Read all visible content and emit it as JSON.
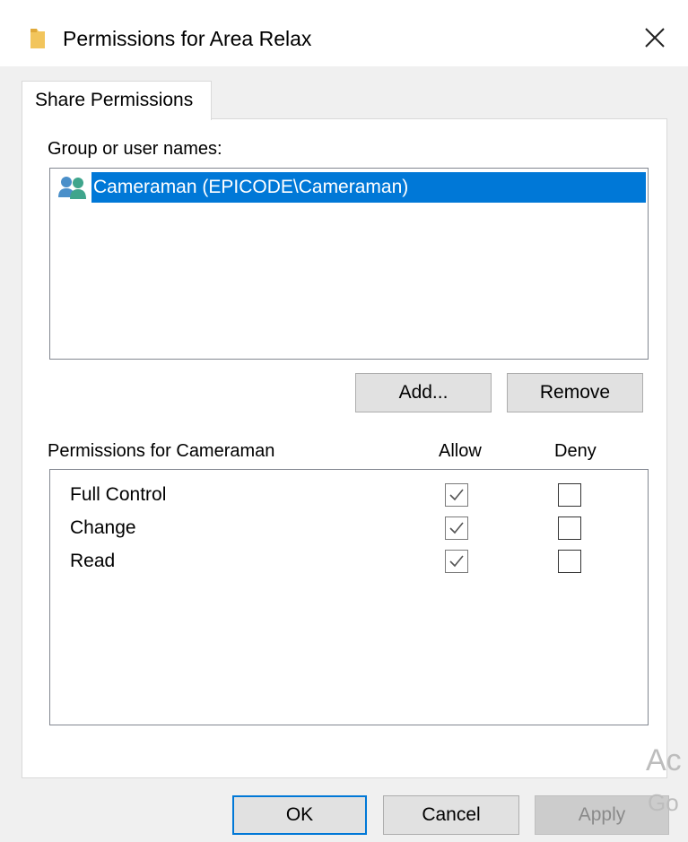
{
  "window": {
    "title": "Permissions for Area Relax",
    "folder_icon_color": "#f2c55c",
    "close_glyph": "✕"
  },
  "tab": {
    "label": "Share Permissions"
  },
  "groups": {
    "label": "Group or user names:",
    "items": [
      {
        "name": "Cameraman (EPICODE\\Cameraman)",
        "selected": true,
        "icon": "users-icon"
      }
    ]
  },
  "buttons": {
    "add": "Add...",
    "remove": "Remove",
    "ok": "OK",
    "cancel": "Cancel",
    "apply": "Apply"
  },
  "permissions": {
    "label": "Permissions for Cameraman",
    "allow_header": "Allow",
    "deny_header": "Deny",
    "rows": [
      {
        "name": "Full Control",
        "allow": true,
        "deny": false
      },
      {
        "name": "Change",
        "allow": true,
        "deny": false
      },
      {
        "name": "Read",
        "allow": true,
        "deny": false
      }
    ]
  },
  "watermark": {
    "line1": "Ac",
    "line2": "Go"
  },
  "colors": {
    "selection": "#0078d7",
    "accent": "#0078d7"
  }
}
